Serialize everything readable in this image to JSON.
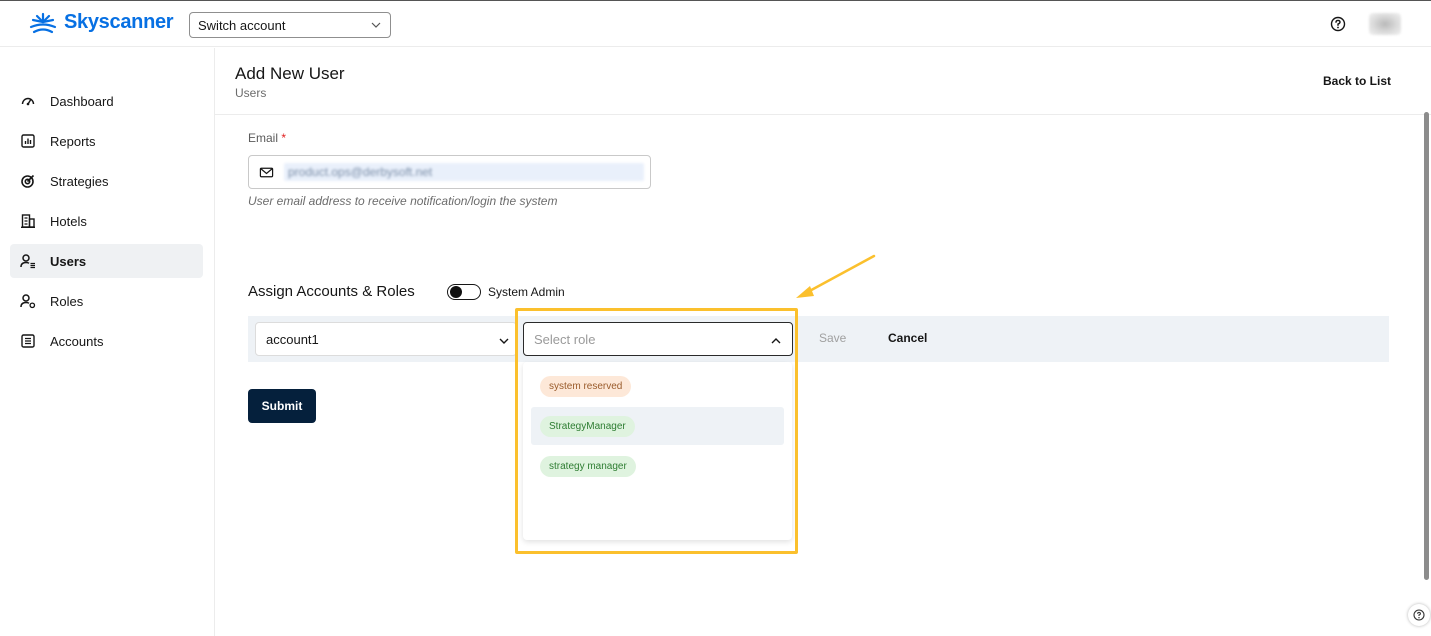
{
  "brand": {
    "name": "Skyscanner",
    "color": "#0770e3"
  },
  "topbar": {
    "switch_account_label": "Switch account"
  },
  "sidebar": {
    "items": [
      {
        "label": "Dashboard",
        "icon": "dashboard-icon",
        "active": false
      },
      {
        "label": "Reports",
        "icon": "reports-icon",
        "active": false
      },
      {
        "label": "Strategies",
        "icon": "strategies-icon",
        "active": false
      },
      {
        "label": "Hotels",
        "icon": "hotels-icon",
        "active": false
      },
      {
        "label": "Users",
        "icon": "users-icon",
        "active": true
      },
      {
        "label": "Roles",
        "icon": "roles-icon",
        "active": false
      },
      {
        "label": "Accounts",
        "icon": "accounts-icon",
        "active": false
      }
    ]
  },
  "header": {
    "title": "Add New User",
    "subtitle": "Users",
    "back_link": "Back to List"
  },
  "form": {
    "email_label": "Email",
    "email_required_mark": "*",
    "email_value": "product.ops@derbysoft.net",
    "email_help": "User email address to receive notification/login the system",
    "assign_title": "Assign Accounts & Roles",
    "system_admin_label": "System Admin",
    "system_admin_on": false,
    "account_value": "account1",
    "role_placeholder": "Select role",
    "save_label": "Save",
    "cancel_label": "Cancel",
    "submit_label": "Submit"
  },
  "role_options": [
    {
      "label": "system reserved",
      "color": "orange"
    },
    {
      "label": "StrategyManager",
      "color": "green",
      "hover": true
    },
    {
      "label": "strategy manager",
      "color": "green"
    }
  ],
  "colors": {
    "submit_bg": "#05203c",
    "highlight": "#fbc02d"
  }
}
